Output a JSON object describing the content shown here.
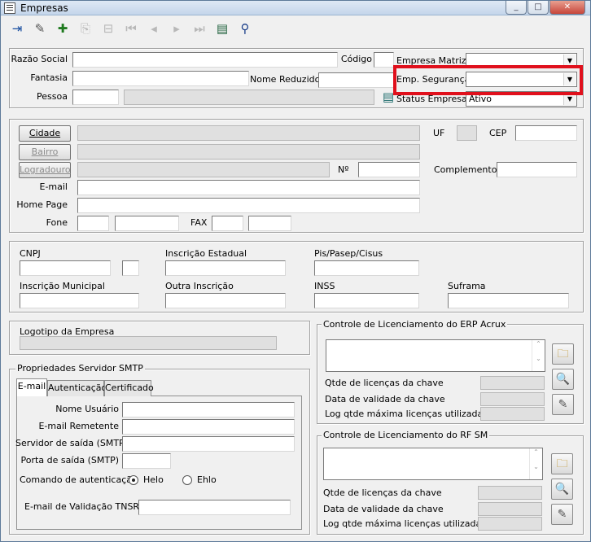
{
  "window": {
    "title": "Empresas",
    "controls": [
      "_",
      "□",
      "✕"
    ]
  },
  "toolbar": {
    "icons": [
      "exit-icon",
      "edit-icon",
      "add-icon",
      "copy-icon",
      "delete-icon",
      "first-icon",
      "prev-icon",
      "next-icon",
      "last-icon",
      "list-icon",
      "search-binoculars-icon"
    ]
  },
  "top": {
    "razao_social_label": "Razão Social",
    "razao_social_value": "",
    "codigo_label": "Código",
    "codigo_value": "",
    "empresa_matriz_label": "Empresa Matriz",
    "empresa_matriz_value": "",
    "fantasia_label": "Fantasia",
    "fantasia_value": "",
    "nome_reduzido_label": "Nome Reduzido",
    "nome_reduzido_value": "",
    "emp_seguranca_label": "Emp. Segurança",
    "emp_seguranca_value": "",
    "pessoa_label": "Pessoa",
    "pessoa_value": "",
    "pessoa_desc": "",
    "status_empresa_label": "Status Empresa",
    "status_empresa_value": "Ativo"
  },
  "address": {
    "cidade_button": "Cidade",
    "cidade_value": "",
    "uf_label": "UF",
    "uf_value": "",
    "cep_label": "CEP",
    "cep_value": "",
    "bairro_button": "Bairro",
    "bairro_value": "",
    "logradouro_button": "Logradouro",
    "logradouro_value": "",
    "numero_label": "Nº",
    "numero_value": "",
    "complemento_label": "Complemento",
    "complemento_value": "",
    "email_label": "E-mail",
    "email_value": "",
    "homepage_label": "Home Page",
    "homepage_value": "",
    "fone_label": "Fone",
    "fone_ddd": "",
    "fone_value": "",
    "fax_label": "FAX",
    "fax_ddd": "",
    "fax_value": ""
  },
  "docs": {
    "cnpj_label": "CNPJ",
    "cnpj_value": "",
    "cnpj_digit": "",
    "ie_label": "Inscrição Estadual",
    "ie_value": "",
    "pis_label": "Pis/Pasep/Cisus",
    "pis_value": "",
    "im_label": "Inscrição Municipal",
    "im_value": "",
    "outra_label": "Outra Inscrição",
    "outra_value": "",
    "inss_label": "INSS",
    "inss_value": "",
    "suframa_label": "Suframa",
    "suframa_value": ""
  },
  "logo": {
    "label": "Logotipo da Empresa",
    "value": ""
  },
  "smtp": {
    "legend": "Propriedades Servidor SMTP",
    "tabs": [
      "E-mail",
      "Autenticação",
      "Certificado"
    ],
    "nome_usuario_label": "Nome Usuário",
    "nome_usuario_value": "",
    "email_remetente_label": "E-mail Remetente",
    "email_remetente_value": "",
    "servidor_label": "Servidor de saída (SMTP)",
    "servidor_value": "",
    "porta_label": "Porta de saída (SMTP)",
    "porta_value": "",
    "comando_label": "Comando de autenticação",
    "helo_label": "Helo",
    "ehlo_label": "Ehlo",
    "selected": "Helo",
    "validacao_label": "E-mail de Validação TNSRV",
    "validacao_value": ""
  },
  "erp": {
    "legend": "Controle de Licenciamento do ERP Acrux",
    "qtde_label": "Qtde de licenças da chave",
    "validade_label": "Data de validade da chave",
    "log_label": "Log qtde máxima licenças utilizadas"
  },
  "rfsm": {
    "legend": "Controle de Licenciamento do RF SM",
    "qtde_label": "Qtde de licenças da chave",
    "validade_label": "Data de validade da chave",
    "log_label": "Log qtde máxima licenças utilizadas"
  },
  "colors": {
    "highlight": "#e0101c",
    "titlebar": "#c4d5ea"
  }
}
